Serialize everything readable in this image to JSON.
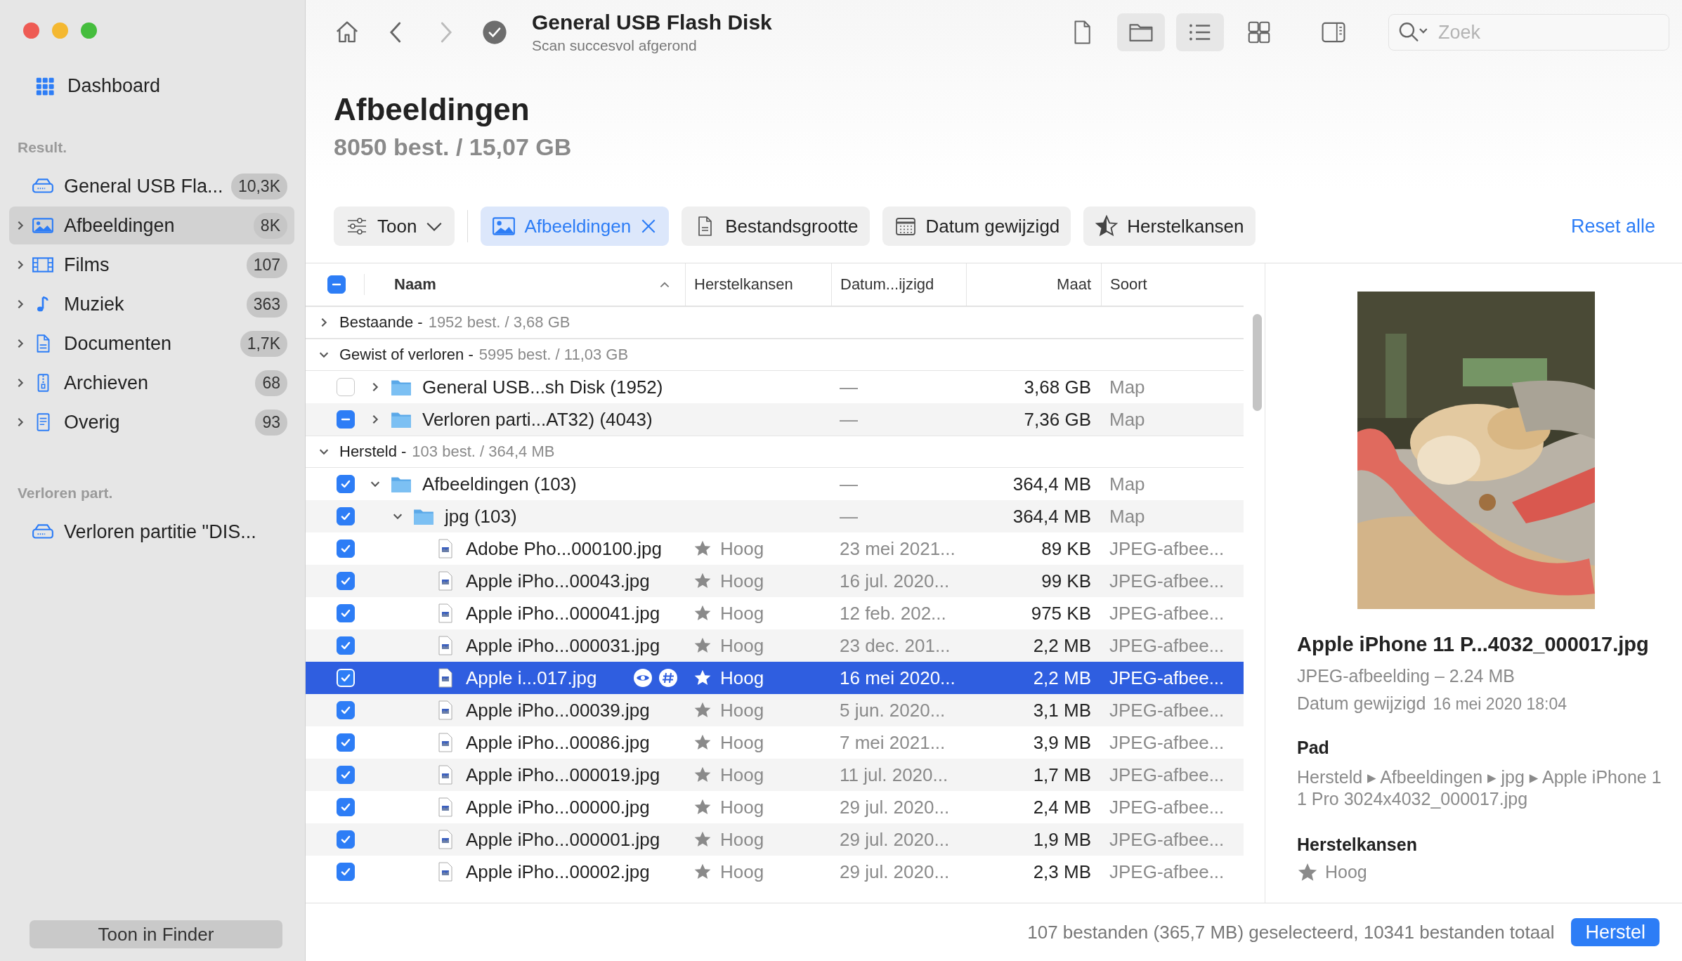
{
  "sidebar": {
    "dashboard": "Dashboard",
    "sections": [
      {
        "title": "Result.",
        "items": [
          {
            "kind": "drive",
            "label": "General USB Fla...",
            "count": "10,3K",
            "expandable": false,
            "selected": false
          },
          {
            "kind": "images",
            "label": "Afbeeldingen",
            "count": "8K",
            "expandable": true,
            "selected": true
          },
          {
            "kind": "films",
            "label": "Films",
            "count": "107",
            "expandable": true,
            "selected": false
          },
          {
            "kind": "music",
            "label": "Muziek",
            "count": "363",
            "expandable": true,
            "selected": false
          },
          {
            "kind": "documents",
            "label": "Documenten",
            "count": "1,7K",
            "expandable": true,
            "selected": false
          },
          {
            "kind": "archives",
            "label": "Archieven",
            "count": "68",
            "expandable": true,
            "selected": false
          },
          {
            "kind": "other",
            "label": "Overig",
            "count": "93",
            "expandable": true,
            "selected": false
          }
        ]
      },
      {
        "title": "Verloren part.",
        "items": [
          {
            "kind": "drive",
            "label": "Verloren partitie \"DIS...",
            "expandable": false,
            "selected": false
          }
        ]
      }
    ],
    "footer_button": "Toon in Finder"
  },
  "toolbar": {
    "nav": [
      {
        "kind": "home",
        "disabled": false
      },
      {
        "kind": "back",
        "disabled": false
      },
      {
        "kind": "forward",
        "disabled": true
      }
    ],
    "title": "General USB Flash Disk",
    "subtitle": "Scan succesvol afgerond",
    "views": [
      {
        "kind": "file",
        "selected": false
      },
      {
        "kind": "folder",
        "selected": true
      },
      {
        "kind": "list",
        "selected": true
      },
      {
        "kind": "grid",
        "selected": false
      },
      {
        "kind": "panel",
        "selected": false
      }
    ],
    "search": {
      "placeholder": "Zoek"
    }
  },
  "header": {
    "title": "Afbeeldingen",
    "summary": "8050 best. / 15,07 GB"
  },
  "filters": [
    {
      "kind": "dropdown",
      "label": "Toon",
      "active": false
    },
    {
      "kind": "images",
      "label": "Afbeeldingen",
      "active": true
    },
    {
      "kind": "size",
      "label": "Bestandsgrootte",
      "active": false
    },
    {
      "kind": "date",
      "label": "Datum gewijzigd",
      "active": false
    },
    {
      "kind": "rating",
      "label": "Herstelkansen",
      "active": false
    }
  ],
  "reset": "Reset alle",
  "table": {
    "checked": false,
    "partial": true,
    "columns": [
      {
        "label": "Naam",
        "sorted": true
      },
      {
        "label": "Herstelkansen",
        "sorted": false
      },
      {
        "label": "Datum...ijzigd",
        "sorted": false
      },
      {
        "label": "Maat",
        "sorted": false
      },
      {
        "label": "Soort",
        "sorted": false
      }
    ],
    "groups": [
      {
        "label": "Bestaande -",
        "detail": "1952 best. / 3,68 GB",
        "expanded": false
      },
      {
        "label": "Gewist of verloren -",
        "detail": "5995 best. / 11,03 GB",
        "expanded": true,
        "children": [
          {
            "kind": "folder",
            "name": "General USB...sh Disk (1952)",
            "date": "—",
            "size": "3,68 GB",
            "type": "Map",
            "checked": false,
            "partial": false,
            "expanded": false,
            "selected": false
          },
          {
            "kind": "folder",
            "name": "Verloren parti...AT32) (4043)",
            "date": "—",
            "size": "7,36 GB",
            "type": "Map",
            "checked": false,
            "partial": true,
            "expanded": false,
            "selected": false
          }
        ]
      },
      {
        "label": "Hersteld -",
        "detail": "103 best. / 364,4 MB",
        "expanded": true,
        "children": [
          {
            "kind": "folder",
            "name": "Afbeeldingen (103)",
            "date": "—",
            "size": "364,4 MB",
            "type": "Map",
            "checked": true,
            "expanded": true,
            "selected": false,
            "children": [
              {
                "kind": "folder",
                "name": "jpg (103)",
                "date": "—",
                "size": "364,4 MB",
                "type": "Map",
                "checked": true,
                "expanded": true,
                "selected": false,
                "children": [
                  {
                    "kind": "file",
                    "name": "Adobe Pho...000100.jpg",
                    "rating": "Hoog",
                    "date": "23 mei 2021...",
                    "size": "89 KB",
                    "type": "JPEG-afbee...",
                    "checked": true,
                    "selected": false
                  },
                  {
                    "kind": "file",
                    "name": "Apple iPho...00043.jpg",
                    "rating": "Hoog",
                    "date": "16 jul. 2020...",
                    "size": "99 KB",
                    "type": "JPEG-afbee...",
                    "checked": true,
                    "selected": false
                  },
                  {
                    "kind": "file",
                    "name": "Apple iPho...000041.jpg",
                    "rating": "Hoog",
                    "date": "12 feb. 202...",
                    "size": "975 KB",
                    "type": "JPEG-afbee...",
                    "checked": true,
                    "selected": false
                  },
                  {
                    "kind": "file",
                    "name": "Apple iPho...000031.jpg",
                    "rating": "Hoog",
                    "date": "23 dec. 201...",
                    "size": "2,2 MB",
                    "type": "JPEG-afbee...",
                    "checked": true,
                    "selected": false
                  },
                  {
                    "kind": "file",
                    "name": "Apple i...017.jpg",
                    "rating": "Hoog",
                    "date": "16 mei 2020...",
                    "size": "2,2 MB",
                    "type": "JPEG-afbee...",
                    "checked": true,
                    "selected": true
                  },
                  {
                    "kind": "file",
                    "name": "Apple iPho...00039.jpg",
                    "rating": "Hoog",
                    "date": "5 jun. 2020...",
                    "size": "3,1 MB",
                    "type": "JPEG-afbee...",
                    "checked": true,
                    "selected": false
                  },
                  {
                    "kind": "file",
                    "name": "Apple iPho...00086.jpg",
                    "rating": "Hoog",
                    "date": "7 mei 2021...",
                    "size": "3,9 MB",
                    "type": "JPEG-afbee...",
                    "checked": true,
                    "selected": false
                  },
                  {
                    "kind": "file",
                    "name": "Apple iPho...000019.jpg",
                    "rating": "Hoog",
                    "date": "11 jul. 2020...",
                    "size": "1,7 MB",
                    "type": "JPEG-afbee...",
                    "checked": true,
                    "selected": false
                  },
                  {
                    "kind": "file",
                    "name": "Apple iPho...00000.jpg",
                    "rating": "Hoog",
                    "date": "29 jul. 2020...",
                    "size": "2,4 MB",
                    "type": "JPEG-afbee...",
                    "checked": true,
                    "selected": false
                  },
                  {
                    "kind": "file",
                    "name": "Apple iPho...000001.jpg",
                    "rating": "Hoog",
                    "date": "29 jul. 2020...",
                    "size": "1,9 MB",
                    "type": "JPEG-afbee...",
                    "checked": true,
                    "selected": false
                  },
                  {
                    "kind": "file",
                    "name": "Apple iPho...00002.jpg",
                    "rating": "Hoog",
                    "date": "29 jul. 2020...",
                    "size": "2,3 MB",
                    "type": "JPEG-afbee...",
                    "checked": true,
                    "selected": false
                  }
                ]
              }
            ]
          }
        ]
      }
    ]
  },
  "preview": {
    "filename": "Apple iPhone 11 P...4032_000017.jpg",
    "type_line": "JPEG-afbeelding – 2.24 MB",
    "date_label": "Datum gewijzigd",
    "date_value": "16 mei 2020 18:04",
    "path_heading": "Pad",
    "path": "Hersteld ▸ Afbeeldingen ▸ jpg ▸ Apple iPhone 11 Pro 3024x4032_000017.jpg",
    "rating_heading": "Herstelkansen",
    "rating": "Hoog"
  },
  "status_bar": {
    "text": "107 bestanden (365,7 MB) geselecteerd, 10341 bestanden totaal",
    "button": "Herstel"
  }
}
